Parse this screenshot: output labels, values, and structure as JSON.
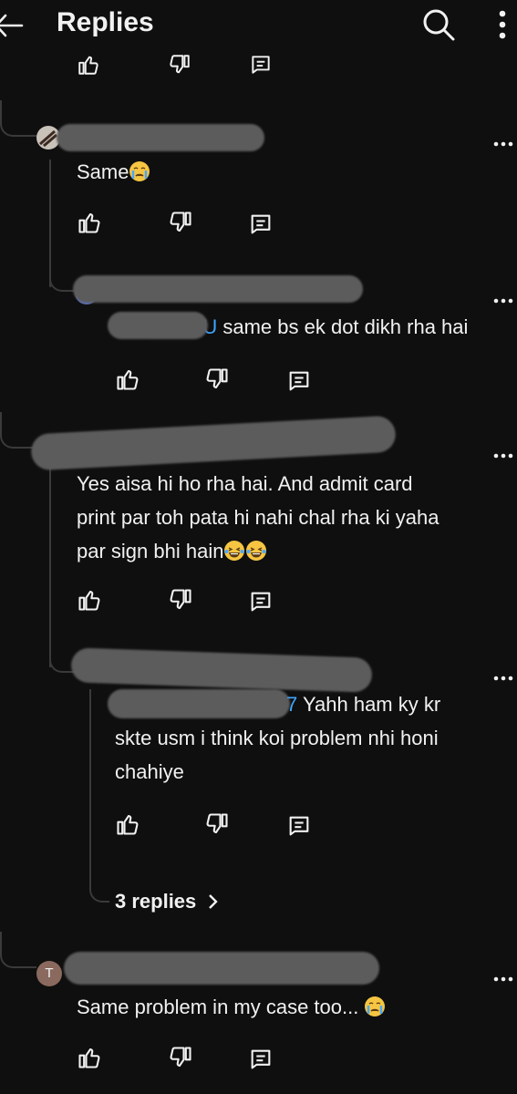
{
  "header": {
    "title": "Replies"
  },
  "comments": [
    {
      "text": "Same",
      "emoji": "crying-face"
    },
    {
      "mention": "@",
      "mention_tail": "U",
      "text": "same bs ek dot dikh rha hai"
    },
    {
      "text_lines": [
        "Yes aisa hi ho rha hai. And admit card",
        "print par toh pata hi nahi chal rha ki yaha",
        "par sign bhi hain"
      ],
      "emoji": "laughing-face"
    },
    {
      "mention_tail": "7",
      "text_lines": [
        "Yahh ham ky kr",
        "skte usm i think koi problem nhi honi",
        "chahiye"
      ]
    },
    {
      "avatar_letter": "T",
      "text": "Same problem in my case too...",
      "emoji": "crying-face"
    }
  ],
  "replies_link": {
    "label": "3 replies"
  },
  "colors": {
    "background": "#0f0f0f",
    "text": "#f1f1f1",
    "mention": "#3ea6ff",
    "thread_line": "#3a3a3a",
    "avatar_t": "#8a6a5e"
  },
  "icons": [
    "back-arrow-icon",
    "search-icon",
    "more-vert-icon",
    "like-icon",
    "dislike-icon",
    "reply-icon",
    "more-horiz-icon",
    "chevron-right-icon"
  ]
}
